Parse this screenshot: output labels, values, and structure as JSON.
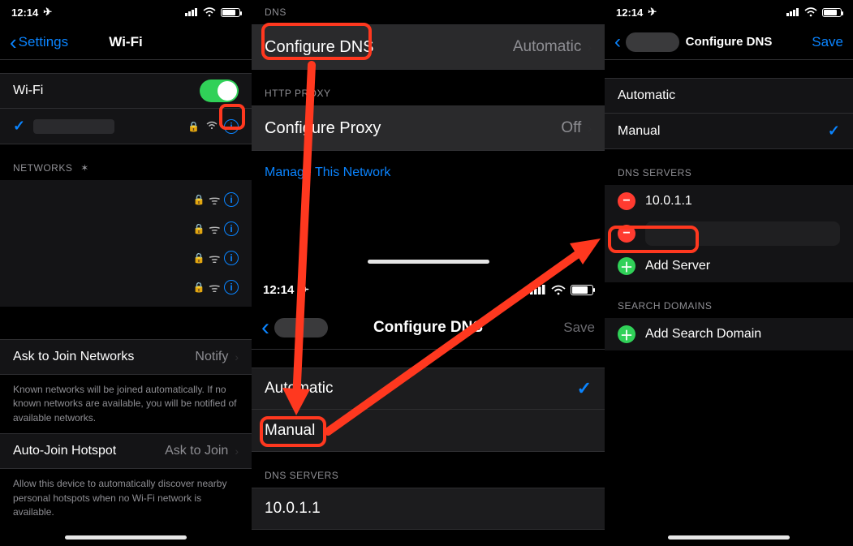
{
  "status": {
    "time": "12:14",
    "loc_glyph": "➤"
  },
  "left": {
    "back_label": "Settings",
    "title": "Wi-Fi",
    "wifi_label": "Wi-Fi",
    "networks_header": "NETWORKS",
    "ask_label": "Ask to Join Networks",
    "ask_value": "Notify",
    "ask_desc": "Known networks will be joined automatically. If no known networks are available, you will be notified of available networks.",
    "hotspot_label": "Auto-Join Hotspot",
    "hotspot_value": "Ask to Join",
    "hotspot_desc": "Allow this device to automatically discover nearby personal hotspots when no Wi-Fi network is available."
  },
  "midTop": {
    "dns_header": "DNS",
    "cfg_dns": "Configure DNS",
    "cfg_dns_value": "Automatic",
    "proxy_header": "HTTP PROXY",
    "cfg_proxy": "Configure Proxy",
    "cfg_proxy_value": "Off",
    "manage": "Manage This Network"
  },
  "midBot": {
    "back_label": "",
    "title": "Configure DNS",
    "save": "Save",
    "automatic": "Automatic",
    "manual": "Manual",
    "dns_servers_header": "DNS SERVERS",
    "server1": "10.0.1.1"
  },
  "right": {
    "back_label": "",
    "title": "Configure DNS",
    "save": "Save",
    "automatic": "Automatic",
    "manual": "Manual",
    "dns_servers_header": "DNS SERVERS",
    "server1": "10.0.1.1",
    "add_server": "Add Server",
    "search_header": "SEARCH DOMAINS",
    "add_search": "Add Search Domain"
  }
}
